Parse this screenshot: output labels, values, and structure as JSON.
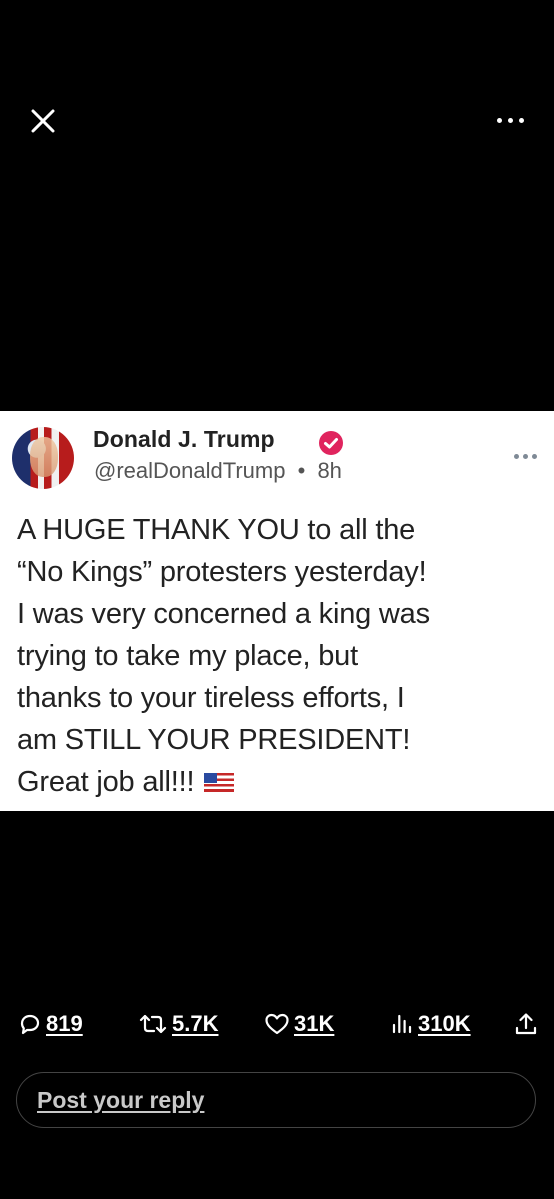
{
  "viewer": {
    "close_icon": "close-icon",
    "more_icon": "more-icon"
  },
  "post": {
    "display_name": "Donald J. Trump",
    "verified_badge": "verified-badge-icon",
    "verified_color": "#e0245e",
    "handle": "@realDonaldTrump",
    "separator": "•",
    "time": "8h",
    "text_lines": [
      "A HUGE THANK YOU to all the",
      "“No Kings” protesters yesterday!",
      "I was very concerned a king was",
      "trying to take my place, but",
      "thanks to your tireless efforts, I",
      "am STILL YOUR PRESIDENT!",
      "Great job all!!!"
    ],
    "emoji": "us-flag-emoji"
  },
  "actions": {
    "replies": "819",
    "reposts": "5.7K",
    "likes": "31K",
    "views": "310K"
  },
  "reply": {
    "placeholder": "Post your reply"
  }
}
